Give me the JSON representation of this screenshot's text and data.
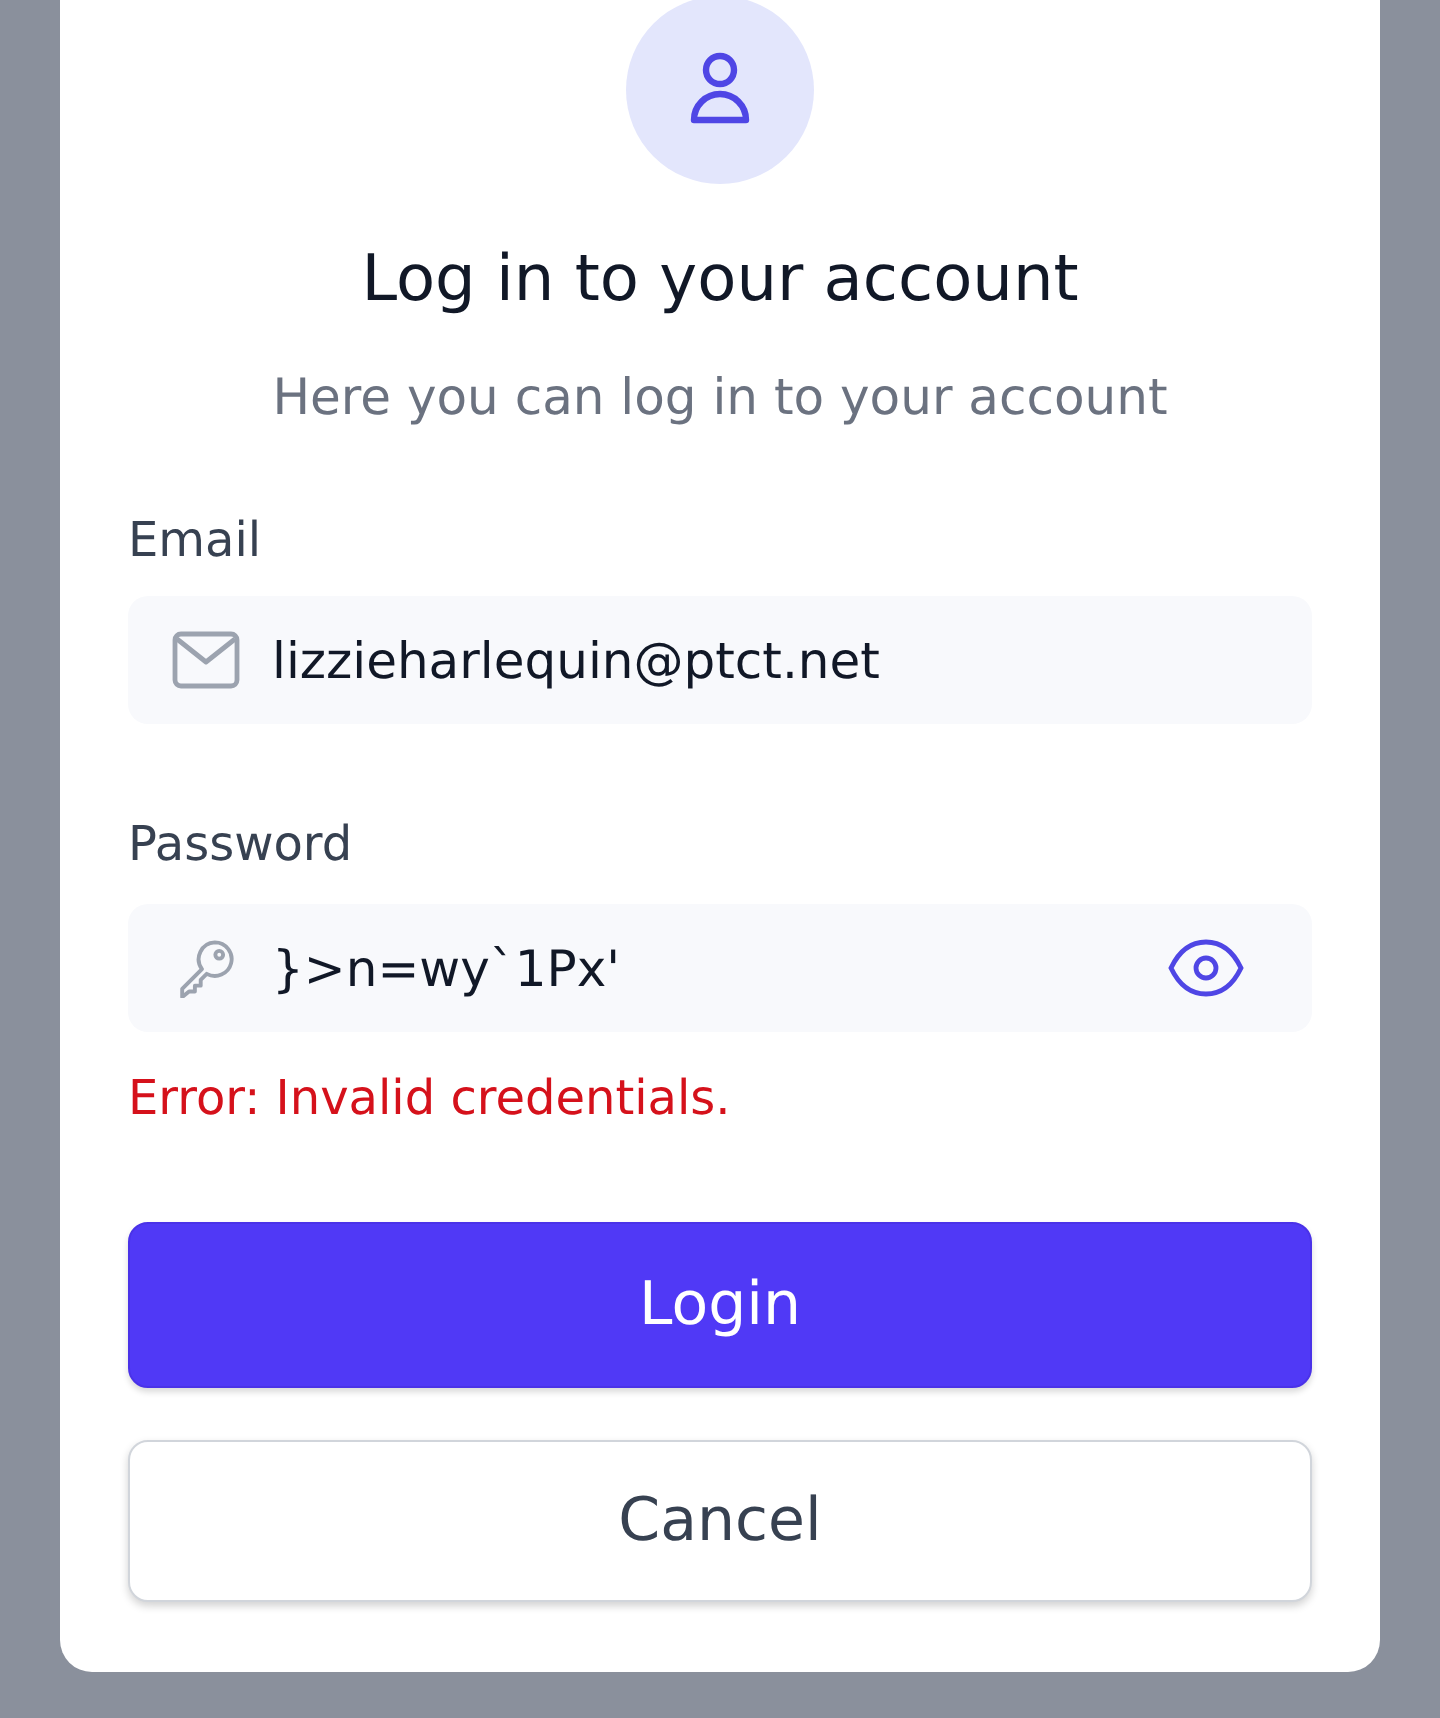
{
  "header": {
    "title": "Log in to your account",
    "subtitle": "Here you can log in to your account"
  },
  "form": {
    "fields": [
      {
        "kind": "email",
        "label": "Email",
        "value": "lizzieharlequin@ptct.net"
      },
      {
        "kind": "password",
        "label": "Password",
        "value": "}>n=wy`1Px'"
      }
    ],
    "error": "Error: Invalid credentials.",
    "buttons": [
      {
        "kind": "primary",
        "label": "Login"
      },
      {
        "kind": "secondary",
        "label": "Cancel"
      }
    ]
  }
}
